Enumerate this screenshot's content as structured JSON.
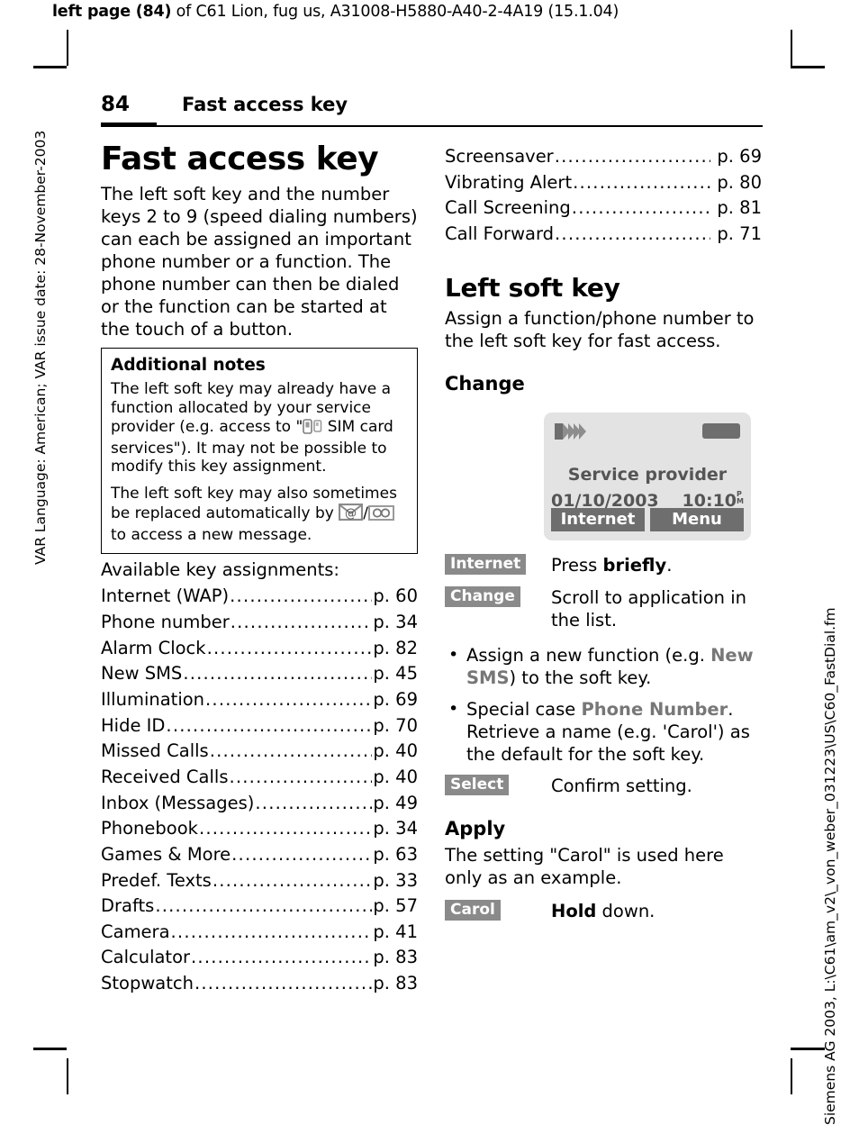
{
  "running_head": {
    "bold_part": "left page (84)",
    "rest": " of C61 Lion, fug us, A31008-H5880-A40-2-4A19 (15.1.04)"
  },
  "side_texts": {
    "left": "VAR Language: American; VAR issue date: 28-November-2003",
    "right": "Siemens AG 2003, L:\\C61\\am_v2\\_von_weber_031223\\US\\C60_FastDial.fm"
  },
  "header": {
    "page_number": "84",
    "title": "Fast access key"
  },
  "left_column": {
    "title": "Fast access key",
    "intro": "The left soft key and the number keys 2 to 9 (speed dialing numbers) can each be assigned an important phone number or a function. The phone number can then be dialed or the function can be started at the touch of a button.",
    "note_box": {
      "title": "Additional notes",
      "para1_a": "The left soft key may already have a function allocated by your service provider (e.g. access to \"",
      "para1_b": " SIM card services\"). It may not be possible to modify this key assignment.",
      "para2_a": "The left soft key may also sometimes be replaced automatically by ",
      "para2_b": "/",
      "para2_c": " to access a new message."
    },
    "list_heading": "Available key assignments:",
    "assignments": [
      {
        "label": "Internet (WAP)",
        "page": "p. 60"
      },
      {
        "label": "Phone number",
        "page": "p. 34"
      },
      {
        "label": "Alarm Clock",
        "page": "p. 82"
      },
      {
        "label": "New SMS",
        "page": "p. 45"
      },
      {
        "label": "Illumination",
        "page": "p. 69"
      },
      {
        "label": "Hide ID",
        "page": "p. 70"
      },
      {
        "label": "Missed Calls",
        "page": "p. 40"
      },
      {
        "label": "Received Calls",
        "page": "p. 40"
      },
      {
        "label": "Inbox (Messages)",
        "page": "p. 49"
      },
      {
        "label": "Phonebook",
        "page": "p. 34"
      },
      {
        "label": "Games & More",
        "page": "p. 63"
      },
      {
        "label": "Predef. Texts",
        "page": "p. 33"
      },
      {
        "label": "Drafts",
        "page": "p. 57"
      },
      {
        "label": "Camera",
        "page": "p. 41"
      },
      {
        "label": "Calculator",
        "page": "p. 83"
      },
      {
        "label": "Stopwatch",
        "page": "p. 83"
      }
    ]
  },
  "right_column": {
    "assignments_continued": [
      {
        "label": "Screensaver",
        "page": "p. 69"
      },
      {
        "label": "Vibrating Alert",
        "page": "p. 80"
      },
      {
        "label": "Call Screening",
        "page": "p. 81"
      },
      {
        "label": "Call Forward",
        "page": "p. 71"
      }
    ],
    "section_title": "Left soft key",
    "section_intro": "Assign a function/phone number to the left soft key for fast access.",
    "change_heading": "Change",
    "phone": {
      "provider": "Service provider",
      "date": "01/10/2003",
      "time": "10:10",
      "ampm_top": "P",
      "ampm_bottom": "M",
      "softkey_left": "Internet",
      "softkey_right": "Menu",
      "signal_filled_bars": 1,
      "signal_outline_bars": 4,
      "screen_bg": "#e3e3e3",
      "element_gray": "#6e6e6e"
    },
    "steps": [
      {
        "key": "Internet",
        "text_plain_1": "Press ",
        "text_bold": "briefly",
        "text_plain_2": "."
      },
      {
        "key": "Change",
        "text_plain_1": "Scroll to application in the list.",
        "text_bold": "",
        "text_plain_2": ""
      }
    ],
    "bullets": [
      {
        "pre": "Assign a new function (e.g. ",
        "gray": "New SMS",
        "post": ") to the soft key."
      },
      {
        "pre": "Special case ",
        "gray": "Phone Number",
        "post": ". Retrieve a name (e.g. 'Carol') as the default for the soft key."
      }
    ],
    "select_step": {
      "key": "Select",
      "text": "Confirm setting."
    },
    "apply_heading": "Apply",
    "apply_text": "The setting \"Carol\" is used here only as an example.",
    "carol_step": {
      "key": "Carol",
      "text_bold": "Hold",
      "text_plain": " down."
    }
  },
  "icons": {
    "sim_card": "sim-card-icon",
    "mail": "mail-at-icon",
    "voicemail": "voicemail-icon",
    "signal": "signal-strength-icon",
    "battery": "battery-icon"
  }
}
